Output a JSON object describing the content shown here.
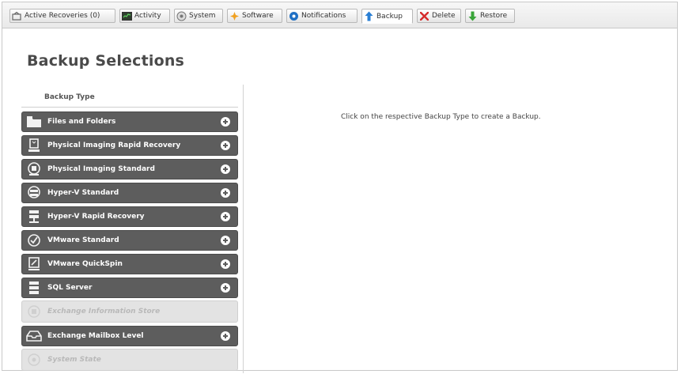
{
  "tabs": [
    {
      "label": "Active Recoveries (0)",
      "icon": "recoveries-icon",
      "active": false
    },
    {
      "label": "Activity",
      "icon": "activity-icon",
      "active": false
    },
    {
      "label": "System",
      "icon": "system-icon",
      "active": false
    },
    {
      "label": "Software",
      "icon": "software-icon",
      "active": false
    },
    {
      "label": "Notifications",
      "icon": "notifications-icon",
      "active": false
    },
    {
      "label": "Backup",
      "icon": "backup-arrow-icon",
      "active": true
    },
    {
      "label": "Delete",
      "icon": "delete-x-icon",
      "active": false
    },
    {
      "label": "Restore",
      "icon": "restore-arrow-icon",
      "active": false
    }
  ],
  "page": {
    "title": "Backup Selections",
    "hint": "Click on the respective Backup Type to create a Backup."
  },
  "backup_types": {
    "header": "Backup Type",
    "items": [
      {
        "label": "Files and Folders",
        "icon": "folder-icon",
        "enabled": true
      },
      {
        "label": "Physical Imaging Rapid Recovery",
        "icon": "physical-rapid-icon",
        "enabled": true
      },
      {
        "label": "Physical Imaging Standard",
        "icon": "physical-standard-icon",
        "enabled": true
      },
      {
        "label": "Hyper-V Standard",
        "icon": "hyperv-standard-icon",
        "enabled": true
      },
      {
        "label": "Hyper-V Rapid Recovery",
        "icon": "hyperv-rapid-icon",
        "enabled": true
      },
      {
        "label": "VMware Standard",
        "icon": "vmware-standard-icon",
        "enabled": true
      },
      {
        "label": "VMware QuickSpin",
        "icon": "vmware-quickspin-icon",
        "enabled": true
      },
      {
        "label": "SQL Server",
        "icon": "sql-server-icon",
        "enabled": true
      },
      {
        "label": "Exchange Information Store",
        "icon": "exchange-store-icon",
        "enabled": false
      },
      {
        "label": "Exchange Mailbox Level",
        "icon": "mailbox-icon",
        "enabled": true
      },
      {
        "label": "System State",
        "icon": "system-state-icon",
        "enabled": false
      }
    ]
  },
  "colors": {
    "item_bg": "#5d5d5d",
    "item_disabled_bg": "#e3e3e3",
    "backup_icon": "#2a7fd4",
    "delete_icon": "#d62b2b",
    "restore_icon": "#3aa53a"
  }
}
